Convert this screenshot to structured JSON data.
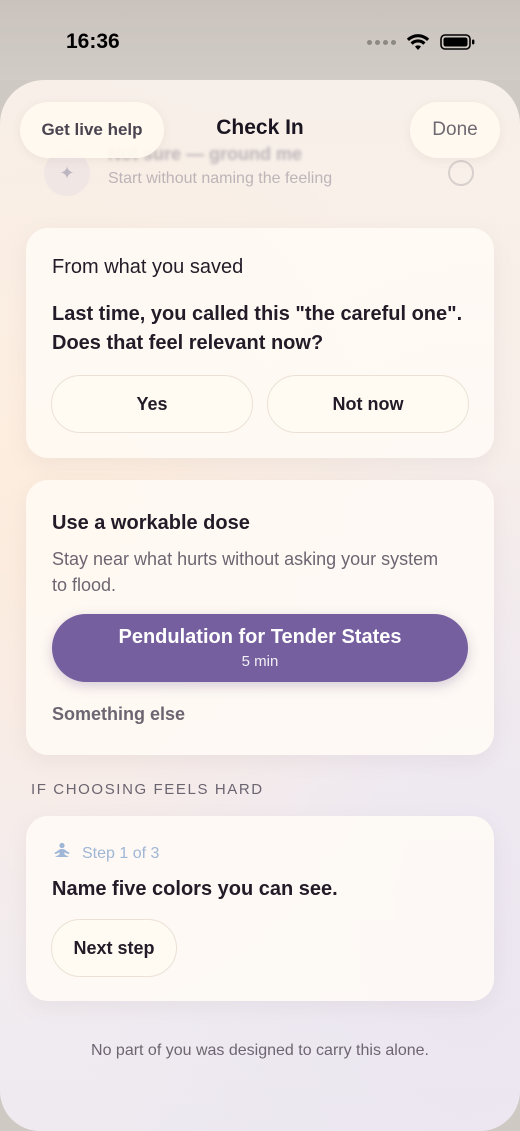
{
  "status_bar": {
    "time": "16:36"
  },
  "nav": {
    "help_label": "Get live help",
    "title": "Check In",
    "done_label": "Done"
  },
  "ghost_option": {
    "title": "Not sure — ground me",
    "subtitle": "Start without naming the feeling"
  },
  "saved_card": {
    "heading": "From what you saved",
    "question": "Last time, you called this \"the careful one\". Does that feel relevant now?",
    "yes_label": "Yes",
    "not_now_label": "Not now"
  },
  "dose_card": {
    "heading": "Use a workable dose",
    "body": "Stay near what hurts without asking your system to flood.",
    "primary_title": "Pendulation for Tender States",
    "primary_duration": "5 min",
    "alt_label": "Something else"
  },
  "section_label": "IF CHOOSING FEELS HARD",
  "step_card": {
    "step_label": "Step 1 of 3",
    "prompt": "Name five colors you can see.",
    "next_label": "Next step"
  },
  "footer": "No part of you was designed to carry this alone.",
  "colors": {
    "accent": "#755f9f",
    "step_blue": "#9fb6d6"
  }
}
